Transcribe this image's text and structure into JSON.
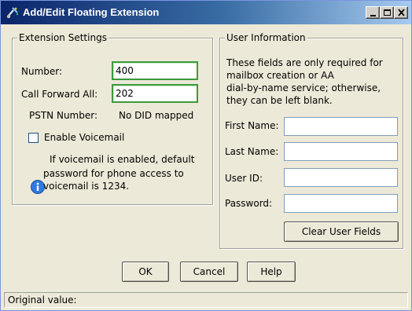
{
  "window": {
    "title": "Add/Edit Floating Extension",
    "minimize_icon": "minimize-icon",
    "maximize_icon": "maximize-icon",
    "close_icon": "close-icon",
    "app_icon": "phone-app-icon"
  },
  "extension_settings": {
    "group_title": "Extension Settings",
    "number_label": "Number:",
    "number_value": "400",
    "call_forward_label": "Call Forward All:",
    "call_forward_value": "202",
    "pstn_label": "PSTN Number:",
    "pstn_value": "No DID mapped",
    "voicemail_label": "Enable Voicemail",
    "voicemail_checked": false,
    "info_icon": "info-icon",
    "note_line1": "If voicemail is enabled, default",
    "note_line2": "password for phone access to",
    "note_line3": "voicemail is 1234."
  },
  "user_information": {
    "group_title": "User Information",
    "desc_line1": "These fields are only required for",
    "desc_line2": "mailbox creation or AA",
    "desc_line3": "dial-by-name service; otherwise,",
    "desc_line4": "they can be left blank.",
    "first_name_label": "First Name:",
    "first_name_value": "",
    "last_name_label": "Last Name:",
    "last_name_value": "",
    "user_id_label": "User ID:",
    "user_id_value": "",
    "password_label": "Password:",
    "password_value": "",
    "clear_button": "Clear User Fields"
  },
  "footer": {
    "ok_button": "OK",
    "cancel_button": "Cancel",
    "help_button": "Help"
  },
  "status": {
    "text": "Original value:"
  },
  "colors": {
    "title_gradient_start": "#0a246a",
    "title_gradient_end": "#a6caf0",
    "focus_border": "#3c9a3c",
    "dialog_face": "#ece9d8"
  }
}
